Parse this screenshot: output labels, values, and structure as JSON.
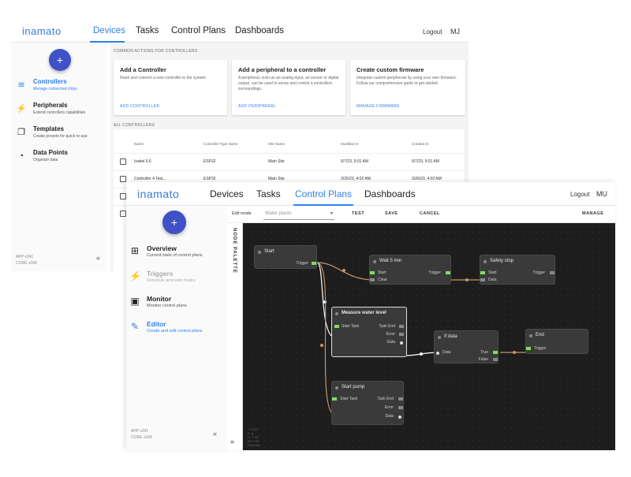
{
  "back_window": {
    "app_name": "inamato",
    "nav": [
      "Devices",
      "Tasks",
      "Control Plans",
      "Dashboards"
    ],
    "nav_active": "Devices",
    "header_right": {
      "logout": "Logout",
      "user": "MJ"
    },
    "fab_icon": "+",
    "sidebar": [
      {
        "title": "Controllers",
        "subtitle": "Manage connected chips",
        "icon": "antenna-icon",
        "glyph": "≋"
      },
      {
        "title": "Peripherals",
        "subtitle": "Extend controllers capabilities",
        "icon": "bolt-icon",
        "glyph": "⚡"
      },
      {
        "title": "Templates",
        "subtitle": "Create presets for quick re-use",
        "icon": "copy-icon",
        "glyph": "❐"
      },
      {
        "title": "Data Points",
        "subtitle": "Organize data",
        "icon": "gauge-icon",
        "glyph": "◔"
      }
    ],
    "version_lines": [
      "APP v241",
      "CORE v164"
    ],
    "collapse_glyph": "«",
    "common_actions_title": "COMMON ACTIONS FOR CONTROLLERS",
    "cards": [
      {
        "title": "Add a Controller",
        "desc": "Flash and connect a new controller to the system.",
        "action": "ADD CONTROLLER"
      },
      {
        "title": "Add a peripheral to a controller",
        "desc": "A peripheral, such as an analog input, air sensor or digital output, can be used to sense and control a controllers surroundings.",
        "action": "ADD PERIPHERAL"
      },
      {
        "title": "Create custom firmware",
        "desc": "Integrate custom peripherals by using your own firmware. Follow our comprehensive guide to get started.",
        "action": "MANAGE FIRMWARE"
      }
    ],
    "all_controllers_title": "ALL CONTROLLERS",
    "table_headers": [
      "Name",
      "Controller Type Name",
      "Site Name",
      "Modified At",
      "Created At"
    ],
    "table_rows": [
      [
        "Isabel 6.6",
        "ESP32",
        "Main Site",
        "6/7/23, 9:01 AM",
        "6/7/23, 9:01 AM"
      ],
      [
        "Controller 4 Test...",
        "ESP32",
        "Main Site",
        "3/26/23, 4:02 AM",
        "3/26/23, 4:02 AM"
      ]
    ]
  },
  "front_window": {
    "app_name": "inamato",
    "nav": [
      "Devices",
      "Tasks",
      "Control Plans",
      "Dashboards"
    ],
    "nav_active": "Control Plans",
    "header_right": {
      "logout": "Logout",
      "user": "MU"
    },
    "fab_icon": "+",
    "sidebar": [
      {
        "title": "Overview",
        "subtitle": "Current state of control plans",
        "icon": "nodes-icon",
        "glyph": "⊞",
        "state": "normal"
      },
      {
        "title": "Triggers",
        "subtitle": "Schedule and web hooks",
        "icon": "bolt-icon",
        "glyph": "⚡",
        "state": "muted"
      },
      {
        "title": "Monitor",
        "subtitle": "Monitor control plans",
        "icon": "monitor-icon",
        "glyph": "▣",
        "state": "normal"
      },
      {
        "title": "Editor",
        "subtitle": "Create and edit control plans",
        "icon": "pencil-icon",
        "glyph": "✎",
        "state": "active"
      }
    ],
    "version_lines": [
      "APP v241",
      "CORE v164"
    ],
    "collapse_glyph": "«",
    "expand_glyph": "»",
    "toolbar": {
      "edit_mode_label": "Edit mode",
      "select_value": "Water plants",
      "select_chevron": "▾",
      "buttons": [
        "TEST",
        "SAVE",
        "CANCEL"
      ],
      "manage": "MANAGE"
    },
    "palette_label": "NODE PALETTE",
    "nodes": {
      "start": {
        "title": "Start",
        "outputs": [
          "Trigger"
        ]
      },
      "wait": {
        "title": "Wait 5 min",
        "inputs": [
          "Start",
          "Clear"
        ],
        "outputs": [
          "Trigger"
        ]
      },
      "safety": {
        "title": "Safety stop",
        "inputs": [
          "Start",
          "Data"
        ],
        "outputs": [
          "Trigger"
        ]
      },
      "measure": {
        "title": "Measure water level",
        "inputs": [
          "Start Task"
        ],
        "outputs": [
          "Task End",
          "Error",
          "Data"
        ]
      },
      "ifdata": {
        "title": "If data",
        "inputs": [
          "Data"
        ],
        "outputs": [
          "True",
          "False"
        ]
      },
      "end": {
        "title": "End",
        "inputs": [
          "Trigger"
        ]
      },
      "pump": {
        "title": "Start pump",
        "inputs": [
          "Start Task"
        ],
        "outputs": [
          "Task End",
          "Error",
          "Data"
        ]
      }
    },
    "canvas_readout": [
      "Y: 0.00",
      "X: 0",
      "H: 7.00",
      "W: 1.00",
      "Selection"
    ],
    "colors": {
      "canvas_bg": "#1d1d1d",
      "node_bg": "#3a3a3a",
      "pin_active": "#7fe05c",
      "trigger_wire": "#c8956a",
      "data_wire": "#ffffff",
      "accent": "#2f80ed",
      "fab": "#3f51c7"
    }
  }
}
